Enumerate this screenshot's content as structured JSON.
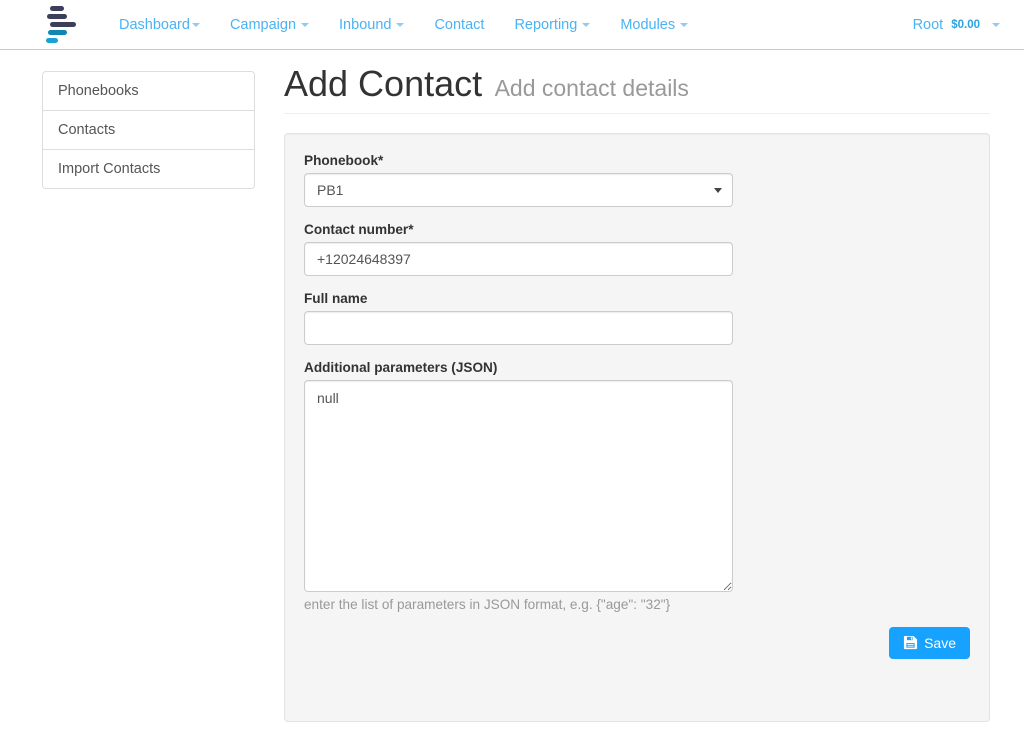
{
  "navbar": {
    "brand_icon": "stacked-bars-logo",
    "items": [
      {
        "label": "Dashboard",
        "has_caret": true
      },
      {
        "label": "Campaign",
        "has_caret": true
      },
      {
        "label": "Inbound",
        "has_caret": true
      },
      {
        "label": "Contact",
        "has_caret": false
      },
      {
        "label": "Reporting",
        "has_caret": true
      },
      {
        "label": "Modules",
        "has_caret": true
      }
    ],
    "user": "Root",
    "balance": "$0.00",
    "caret_icon": "chevron-down-icon"
  },
  "sidebar": {
    "items": [
      {
        "label": "Phonebooks"
      },
      {
        "label": "Contacts"
      },
      {
        "label": "Import Contacts"
      }
    ]
  },
  "page": {
    "title": "Add Contact",
    "subtitle": "Add contact details"
  },
  "form": {
    "phonebook": {
      "label": "Phonebook*",
      "value": "PB1",
      "options": [
        "PB1"
      ]
    },
    "contact_number": {
      "label": "Contact number*",
      "value": "+12024648397",
      "placeholder": ""
    },
    "full_name": {
      "label": "Full name",
      "value": "",
      "placeholder": ""
    },
    "additional_parameters": {
      "label": "Additional parameters (JSON)",
      "value": "null",
      "placeholder": "",
      "help": "enter the list of parameters in JSON format, e.g. {\"age\": \"32\"}"
    },
    "save_button": {
      "label": "Save",
      "icon": "floppy-disk-save-icon"
    }
  },
  "colors": {
    "nav_link": "#4ab3f4",
    "primary_button": "#17a2ff",
    "panel_background": "#f5f5f5",
    "logo_dark": "#3d3d5c",
    "logo_blue": "#16a3d4"
  }
}
